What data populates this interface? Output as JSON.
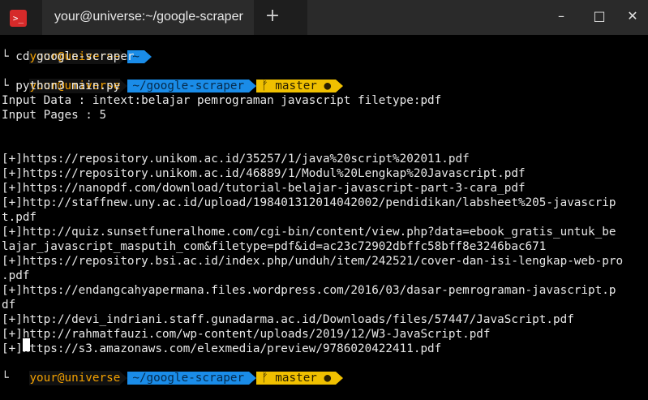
{
  "window": {
    "icon_label": ">_",
    "tab_title": "your@universe:~/google-scraper",
    "new_tab": "+",
    "minimize": "–",
    "maximize": "□",
    "close": "✕"
  },
  "prompts": [
    {
      "user": "your@universe",
      "path": "~",
      "branch": null
    },
    {
      "user": "your@universe",
      "path": "~/google-scraper",
      "branch": "ᚠ master ●"
    },
    {
      "user": "your@universe",
      "path": "~/google-scraper",
      "branch": "ᚠ master ●"
    }
  ],
  "commands": [
    "└ cd google-scraper",
    "└ python3 main.py"
  ],
  "output": [
    "Input Data : intext:belajar pemrograman javascript filetype:pdf",
    "Input Pages : 5",
    "",
    "",
    "[+]https://repository.unikom.ac.id/35257/1/java%20script%202011.pdf",
    "[+]https://repository.unikom.ac.id/46889/1/Modul%20Lengkap%20Javascript.pdf",
    "[+]https://nanopdf.com/download/tutorial-belajar-javascript-part-3-cara_pdf",
    "[+]http://staffnew.uny.ac.id/upload/198401312014042002/pendidikan/labsheet%205-javascrip",
    "t.pdf",
    "[+]http://quiz.sunsetfuneralhome.com/cgi-bin/content/view.php?data=ebook_gratis_untuk_be",
    "lajar_javascript_masputih_com&filetype=pdf&id=ac23c72902dbffc58bff8e3246bac671",
    "[+]https://repository.bsi.ac.id/index.php/unduh/item/242521/cover-dan-isi-lengkap-web-pro",
    ".pdf",
    "[+]https://endangcahyapermana.files.wordpress.com/2016/03/dasar-pemrograman-javascript.p",
    "df",
    "[+]http://devi_indriani.staff.gunadarma.ac.id/Downloads/files/57447/JavaScript.pdf",
    "[+]http://rahmatfauzi.com/wp-content/uploads/2019/12/W3-JavaScript.pdf",
    "[+]https://s3.amazonaws.com/elexmedia/preview/9786020422411.pdf"
  ],
  "final_prompt_prefix": "└"
}
